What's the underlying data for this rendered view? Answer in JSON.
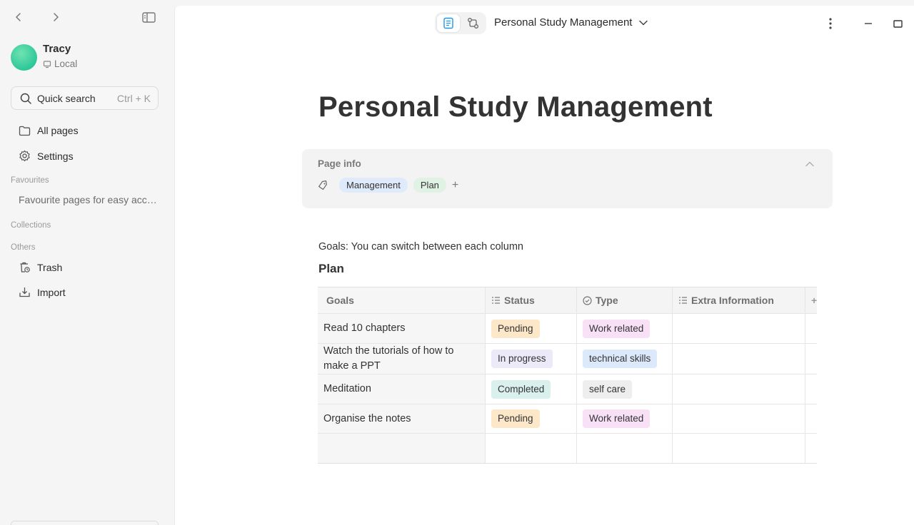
{
  "sidebar": {
    "user": {
      "name": "Tracy",
      "workspace": "Local"
    },
    "search": {
      "label": "Quick search",
      "shortcut": "Ctrl + K"
    },
    "nav": [
      {
        "label": "All pages",
        "icon": "folder-icon"
      },
      {
        "label": "Settings",
        "icon": "gear-icon"
      }
    ],
    "sections": {
      "favourites": "Favourites",
      "collections": "Collections",
      "others": "Others"
    },
    "favourites_placeholder": "Favourite pages for easy access",
    "others": [
      {
        "label": "Trash",
        "icon": "trash-icon"
      },
      {
        "label": "Import",
        "icon": "import-icon"
      }
    ]
  },
  "topbar": {
    "doc_title": "Personal Study Management",
    "active_mode": "page"
  },
  "page": {
    "title": "Personal Study Management",
    "info": {
      "title": "Page info",
      "tags": [
        {
          "label": "Management",
          "color": "#dfeafb"
        },
        {
          "label": "Plan",
          "color": "#dff2e3"
        }
      ],
      "add": "+"
    },
    "goals_text": "Goals: You can switch between each column",
    "plan_heading": "Plan",
    "table": {
      "columns": [
        {
          "label": "Goals",
          "icon": ""
        },
        {
          "label": "Status",
          "icon": "list-icon"
        },
        {
          "label": "Type",
          "icon": "check-circle-icon"
        },
        {
          "label": "Extra Information",
          "icon": "list-icon"
        }
      ],
      "rows": [
        {
          "goal": "Read 10 chapters",
          "status": "Pending",
          "status_color": "#fde7c9",
          "type": "Work related",
          "type_color": "#f8e0f6"
        },
        {
          "goal": "Watch the tutorials of how to make a PPT",
          "status": "In progress",
          "status_color": "#ece9f8",
          "type": "technical skills",
          "type_color": "#dce9fb"
        },
        {
          "goal": "Meditation",
          "status": "Completed",
          "status_color": "#d9f0ec",
          "type": "self care",
          "type_color": "#eeeeee"
        },
        {
          "goal": "Organise the notes",
          "status": "Pending",
          "status_color": "#fde7c9",
          "type": "Work related",
          "type_color": "#f8e0f6"
        }
      ]
    }
  }
}
